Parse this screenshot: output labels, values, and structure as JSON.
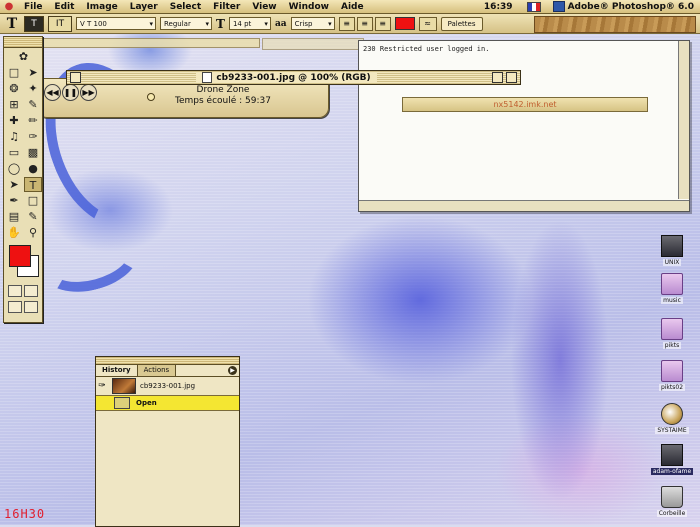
{
  "menubar": {
    "items": [
      "File",
      "Edit",
      "Image",
      "Layer",
      "Select",
      "Filter",
      "View",
      "Window",
      "Aide"
    ],
    "clock": "16:39",
    "app_name": "Adobe® Photoshop® 6.0"
  },
  "options_bar": {
    "font_family": "V T 100",
    "font_style": "Regular",
    "font_size": "14 pt",
    "anti_alias": "Crisp",
    "palettes_label": "Palettes",
    "text_color": "#e11111"
  },
  "audio_player": {
    "track": "Drone Zone",
    "elapsed": "Temps écoulé : 59:37"
  },
  "document": {
    "title": "cb9233-001.jpg @ 100% (RGB)"
  },
  "terminal": {
    "line1": "230 Restricted user logged in."
  },
  "host_bar": {
    "host": "nx5142.imk.net"
  },
  "history": {
    "tabs": [
      "History",
      "Actions"
    ],
    "snapshot": "cb9233-001.jpg",
    "steps": [
      "Open"
    ]
  },
  "desktop_icons": [
    {
      "label": "UNIX",
      "kind": "hd"
    },
    {
      "label": "music",
      "kind": "folder"
    },
    {
      "label": "pikts",
      "kind": "folder"
    },
    {
      "label": "pikts02",
      "kind": "folder"
    },
    {
      "label": "SYSTAIME",
      "kind": "sys"
    },
    {
      "label": "adam-ofame",
      "kind": "hd"
    },
    {
      "label": "Corbeille",
      "kind": "trash"
    }
  ],
  "watermark": "16H30",
  "colors": {
    "foreground": "#e11111",
    "background": "#ffffff"
  }
}
